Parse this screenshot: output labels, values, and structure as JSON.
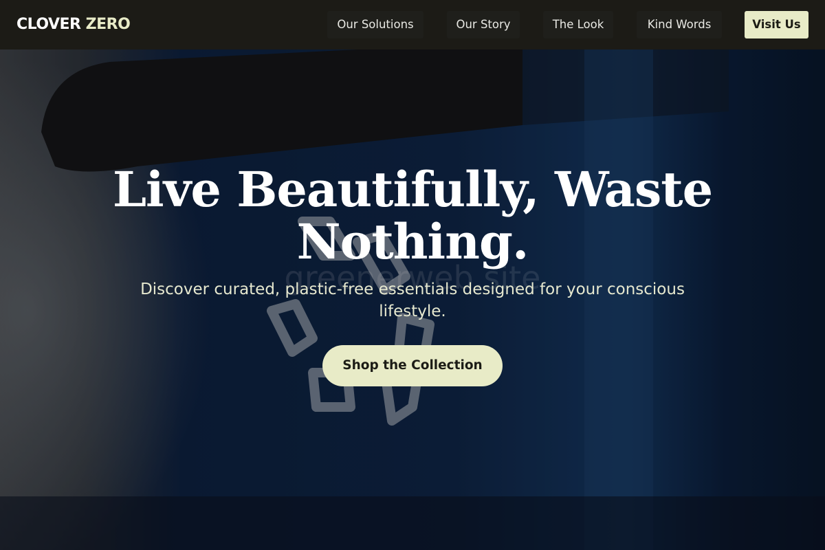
{
  "header": {
    "logo": {
      "part1": "CLOVER",
      "part2": "ZERO"
    },
    "nav": [
      {
        "label": "Our Solutions"
      },
      {
        "label": "Our Story"
      },
      {
        "label": "The Look"
      },
      {
        "label": "Kind Words"
      }
    ],
    "cta_label": "Visit Us"
  },
  "hero": {
    "title": "Live Beautifully, Waste Nothing.",
    "subtitle": "Discover curated, plastic-free essentials designed for your conscious lifestyle.",
    "cta_label": "Shop the Collection",
    "background_image": "blue-recycling-bin-photo",
    "watermark": "greenerweb.site"
  },
  "colors": {
    "header_bg": "#1c1b16",
    "accent": "#e8ebc7",
    "text_light": "#ffffff"
  }
}
